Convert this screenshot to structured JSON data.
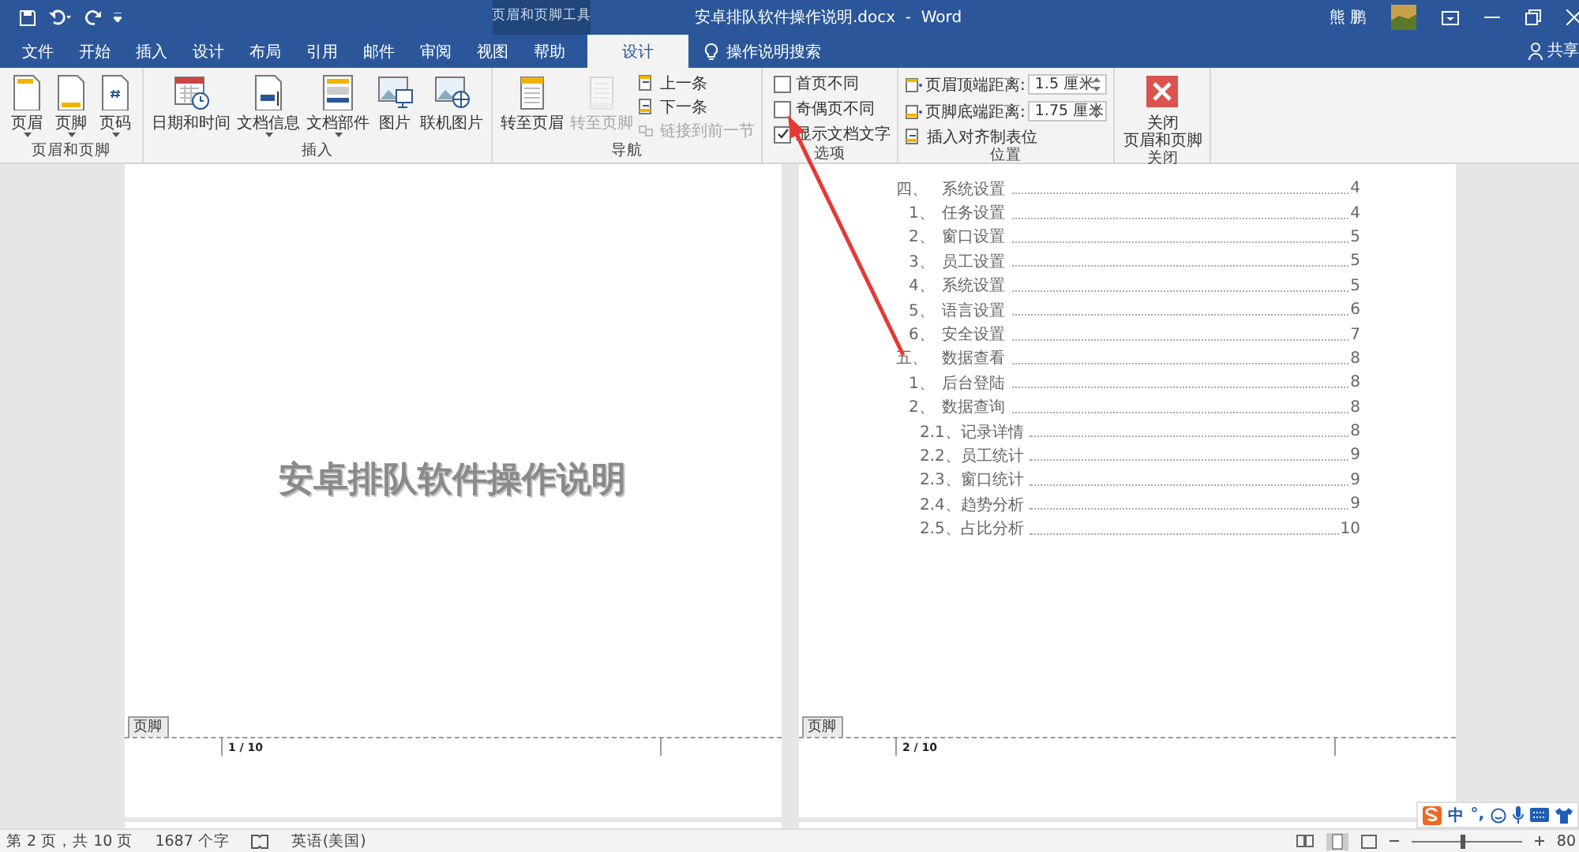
{
  "title_bar": {
    "context_tool": "页眉和页脚工具",
    "title": "安卓排队软件操作说明.docx  -  Word",
    "user": "熊 鹏"
  },
  "tabs": [
    {
      "label": "文件",
      "selected": false
    },
    {
      "label": "开始",
      "selected": false
    },
    {
      "label": "插入",
      "selected": false
    },
    {
      "label": "设计",
      "selected": false
    },
    {
      "label": "布局",
      "selected": false
    },
    {
      "label": "引用",
      "selected": false
    },
    {
      "label": "邮件",
      "selected": false
    },
    {
      "label": "审阅",
      "selected": false
    },
    {
      "label": "视图",
      "selected": false
    },
    {
      "label": "帮助",
      "selected": false
    },
    {
      "label": "设计",
      "selected": true
    }
  ],
  "tell_me": "操作说明搜索",
  "share": "共享",
  "ribbon": {
    "groups": [
      {
        "label": "页眉和页脚",
        "items": [
          {
            "kind": "large",
            "label": "页眉",
            "dropdown": true,
            "disabled": false
          },
          {
            "kind": "large",
            "label": "页脚",
            "dropdown": true,
            "disabled": false
          },
          {
            "kind": "large",
            "label": "页码",
            "dropdown": true,
            "disabled": false
          }
        ]
      },
      {
        "label": "插入",
        "items": [
          {
            "kind": "large",
            "label": "日期和时间",
            "dropdown": false,
            "disabled": false
          },
          {
            "kind": "large",
            "label": "文档信息",
            "dropdown": true,
            "disabled": false
          },
          {
            "kind": "large",
            "label": "文档部件",
            "dropdown": true,
            "disabled": false
          },
          {
            "kind": "large",
            "label": "图片",
            "dropdown": false,
            "disabled": false
          },
          {
            "kind": "large",
            "label": "联机图片",
            "dropdown": false,
            "disabled": false
          }
        ]
      },
      {
        "label": "导航",
        "items": [
          {
            "kind": "large",
            "label": "转至页眉",
            "dropdown": false,
            "disabled": false
          },
          {
            "kind": "large",
            "label": "转至页脚",
            "dropdown": false,
            "disabled": true
          },
          {
            "kind": "small",
            "label": "上一条",
            "disabled": false
          },
          {
            "kind": "small",
            "label": "下一条",
            "disabled": false
          },
          {
            "kind": "small",
            "label": "链接到前一节",
            "disabled": true
          }
        ]
      },
      {
        "label": "选项",
        "items": [
          {
            "kind": "checkbox",
            "label": "首页不同",
            "checked": false
          },
          {
            "kind": "checkbox",
            "label": "奇偶页不同",
            "checked": false
          },
          {
            "kind": "checkbox",
            "label": "显示文档文字",
            "checked": true
          }
        ]
      },
      {
        "label": "位置",
        "items": [
          {
            "kind": "spin",
            "label": "页眉顶端距离:",
            "value": "1.5 厘米"
          },
          {
            "kind": "spin",
            "label": "页脚底端距离:",
            "value": "1.75 厘米"
          },
          {
            "kind": "small",
            "label": "插入对齐制表位",
            "disabled": false
          }
        ]
      },
      {
        "label": "关闭",
        "items": [
          {
            "kind": "large",
            "lines": [
              "关闭",
              "页眉和页脚"
            ],
            "dropdown": false,
            "disabled": false
          }
        ]
      }
    ]
  },
  "pages": [
    {
      "title": "安卓排队软件操作说明",
      "footer_tag": "页脚",
      "footer": "1 / 10"
    },
    {
      "toc": [
        {
          "num": "四、",
          "text": "系统设置",
          "page": "4",
          "children": [
            {
              "num": "1、",
              "text": "任务设置",
              "page": "4"
            },
            {
              "num": "2、",
              "text": "窗口设置",
              "page": "5"
            },
            {
              "num": "3、",
              "text": "员工设置",
              "page": "5"
            },
            {
              "num": "4、",
              "text": "系统设置",
              "page": "5"
            },
            {
              "num": "5、",
              "text": "语言设置",
              "page": "6"
            },
            {
              "num": "6、",
              "text": "安全设置",
              "page": "7"
            }
          ]
        },
        {
          "num": "五、",
          "text": "数据查看",
          "page": "8",
          "children": [
            {
              "num": "1、",
              "text": "后台登陆",
              "page": "8"
            },
            {
              "num": "2、",
              "text": "数据查询",
              "page": "8",
              "children": [
                {
                  "num": "2.1、",
                  "text": "记录详情",
                  "page": "8"
                },
                {
                  "num": "2.2、",
                  "text": "员工统计",
                  "page": "9"
                },
                {
                  "num": "2.3、",
                  "text": "窗口统计",
                  "page": "9"
                },
                {
                  "num": "2.4、",
                  "text": "趋势分析",
                  "page": "9"
                },
                {
                  "num": "2.5、",
                  "text": "占比分析",
                  "page": "10"
                }
              ]
            }
          ]
        }
      ],
      "footer_tag": "页脚",
      "footer": "2 / 10"
    }
  ],
  "status_bar": {
    "page": "第 2 页，共 10 页",
    "words": "1687 个字",
    "language": "英语(美国)",
    "zoom": {
      "level": 0.45,
      "label": "80"
    }
  },
  "ime": {
    "mode": "中",
    "punct": "°,"
  }
}
